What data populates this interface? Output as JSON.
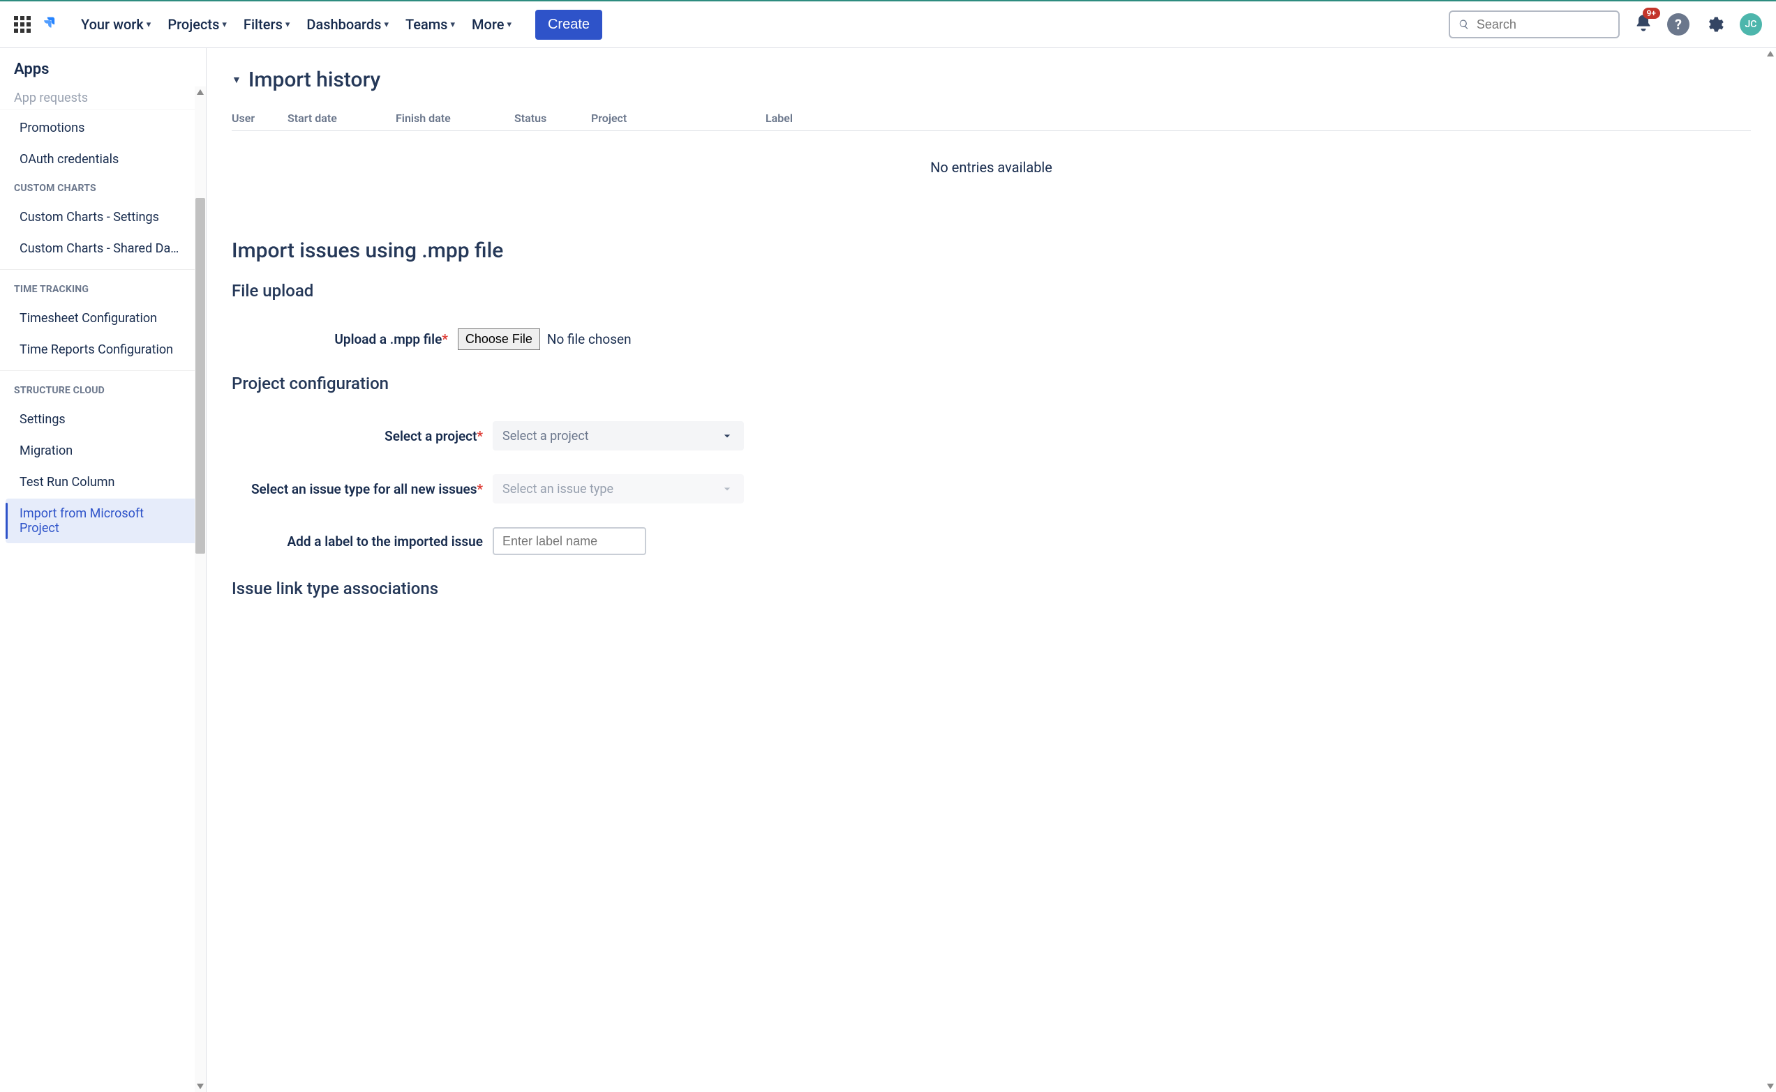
{
  "topnav": {
    "items": [
      "Your work",
      "Projects",
      "Filters",
      "Dashboards",
      "Teams",
      "More"
    ],
    "create": "Create",
    "search_placeholder": "Search",
    "badge": "9+",
    "avatar": "JC"
  },
  "sidebar": {
    "title": "Apps",
    "top_cut": "App requests",
    "items_top": [
      "Promotions",
      "OAuth credentials"
    ],
    "groups": [
      {
        "heading": "CUSTOM CHARTS",
        "items": [
          "Custom Charts - Settings",
          "Custom Charts - Shared Das…"
        ]
      },
      {
        "heading": "TIME TRACKING",
        "items": [
          "Timesheet Configuration",
          "Time Reports Configuration"
        ]
      },
      {
        "heading": "STRUCTURE CLOUD",
        "items": [
          "Settings",
          "Migration",
          "Test Run Column",
          "Import from Microsoft Project"
        ]
      }
    ],
    "active": "Import from Microsoft Project"
  },
  "main": {
    "import_history_title": "Import history",
    "history_cols": [
      "User",
      "Start date",
      "Finish date",
      "Status",
      "Project",
      "Label"
    ],
    "history_empty": "No entries available",
    "section_title": "Import issues using .mpp file",
    "file_upload_heading": "File upload",
    "upload_label": "Upload a .mpp file",
    "choose_file": "Choose File",
    "no_file": "No file chosen",
    "project_config_heading": "Project configuration",
    "select_project_label": "Select a project",
    "select_project_placeholder": "Select a project",
    "select_issue_label": "Select an issue type for all new issues",
    "select_issue_placeholder": "Select an issue type",
    "add_label_label": "Add a label to the imported issue",
    "add_label_placeholder": "Enter label name",
    "issue_link_heading": "Issue link type associations"
  }
}
